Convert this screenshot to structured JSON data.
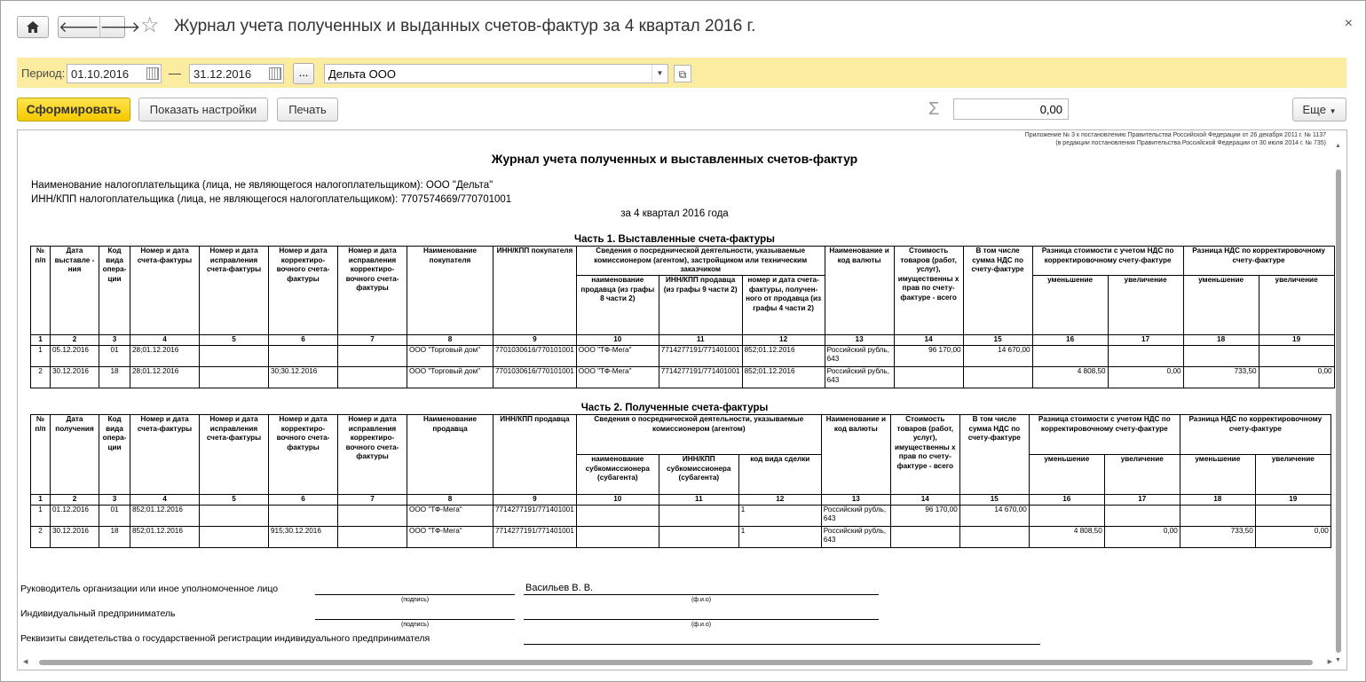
{
  "window": {
    "title": "Журнал учета полученных и выданных счетов-фактур за 4 квартал 2016 г.",
    "home_icon": "home-icon",
    "back_icon": "arrow-left-icon",
    "forward_icon": "arrow-right-icon",
    "favorite_icon": "star-icon",
    "close_label": "×"
  },
  "filter": {
    "period_label": "Период:",
    "date_from": "01.10.2016",
    "dash": "—",
    "date_to": "31.12.2016",
    "select_period_label": "...",
    "organization": "Дельта ООО"
  },
  "toolbar": {
    "generate_label": "Сформировать",
    "settings_label": "Показать настройки",
    "print_label": "Печать",
    "sum_value": "0,00",
    "more_label": "Еще"
  },
  "report": {
    "note_line1": "Приложение № 3 к постановлению Правительства Российской Федерации от 26 декабря 2011 г. № 1137",
    "note_line2": "(в редакции постановления Правительства Российской Федерации от 30 июля 2014 г. № 735)",
    "title": "Журнал учета полученных и выставленных счетов-фактур",
    "taxpayer_name": "Наименование налогоплательщика (лица, не являющегося налогоплательщиком): ООО \"Дельта\"",
    "taxpayer_inn": "ИНН/КПП налогоплательщика (лица, не являющегося налогоплательщиком): 7707574669/770701001",
    "period": "за 4 квартал 2016 года",
    "part1": {
      "title": "Часть 1. Выставленные счета-фактуры",
      "headers": {
        "h1": "№ п/п",
        "h2": "Дата выставле - ния",
        "h3": "Код вида опера- ции",
        "h4": "Номер и дата счета-фактуры",
        "h5": "Номер и дата исправления счета-фактуры",
        "h6": "Номер и дата корректиро- вочного счета-фактуры",
        "h7": "Номер и дата исправления корректиро- вочного счета- фактуры",
        "h8": "Наименование покупателя",
        "h9": "ИНН/КПП покупателя",
        "h10_12": "Сведения о посреднической деятельности, указываемые комиссионером (агентом), застройщиком или техническим заказчиком",
        "h10": "наименование продавца (из графы 8 части 2)",
        "h11": "ИНН/КПП продавца (из графы 9 части 2)",
        "h12": "номер и дата счета- фактуры, получен- ного от продавца (из графы 4 части 2)",
        "h13": "Наименование и код валюты",
        "h14": "Стоимость товаров (работ, услуг), имущественны х прав по счету- фактуре - всего",
        "h15": "В том числе сумма НДС по счету-фактуре",
        "h16_17": "Разница стоимости с учетом НДС по корректировочному счету-фактуре",
        "h16": "уменьшение",
        "h17": "увеличение",
        "h18_19": "Разница НДС по корректировочному счету-фактуре",
        "h18": "уменьшение",
        "h19": "увеличение"
      },
      "col_numbers": [
        "1",
        "2",
        "3",
        "4",
        "5",
        "6",
        "7",
        "8",
        "9",
        "10",
        "11",
        "12",
        "13",
        "14",
        "15",
        "16",
        "17",
        "18",
        "19"
      ],
      "rows": [
        [
          "1",
          "05.12.2016",
          "01",
          "28;01.12.2016",
          "",
          "",
          "",
          "ООО \"Торговый дом\"",
          "7701030616/770101001",
          "ООО \"ТФ-Мега\"",
          "7714277191/771401001",
          "852;01.12.2016",
          "Российский рубль, 643",
          "96 170,00",
          "14 670,00",
          "",
          "",
          "",
          ""
        ],
        [
          "2",
          "30.12.2016",
          "18",
          "28;01.12.2016",
          "",
          "30;30.12.2016",
          "",
          "ООО \"Торговый дом\"",
          "7701030616/770101001",
          "ООО \"ТФ-Мега\"",
          "7714277191/771401001",
          "852;01.12.2016",
          "Российский рубль, 643",
          "",
          "",
          "4 808,50",
          "0,00",
          "733,50",
          "0,00"
        ]
      ]
    },
    "part2": {
      "title": "Часть 2. Полученные счета-фактуры",
      "headers": {
        "h1": "№ п/п",
        "h2": "Дата получения",
        "h3": "Код вида опера- ции",
        "h4": "Номер и дата счета-фактуры",
        "h5": "Номер и дата исправления счета-фактуры",
        "h6": "Номер и дата корректиро- вочного счета-фактуры",
        "h7": "Номер и дата исправления корректиро- вочного счета- фактуры",
        "h8": "Наименование продавца",
        "h9": "ИНН/КПП продавца",
        "h10_12": "Сведения о посреднической деятельности, указываемые комиссионером (агентом)",
        "h10": "наименование субкомиссионера (субагента)",
        "h11": "ИНН/КПП субкомиссионера (субагента)",
        "h12": "код вида сделки",
        "h13": "Наименование и код валюты",
        "h14": "Стоимость товаров (работ, услуг), имущественны х прав по счету- фактуре - всего",
        "h15": "В том числе сумма НДС по счету-фактуре",
        "h16_17": "Разница стоимости с учетом НДС по корректировочному счету-фактуре",
        "h16": "уменьшение",
        "h17": "увеличение",
        "h18_19": "Разница НДС по корректировочному счету-фактуре",
        "h18": "уменьшение",
        "h19": "увеличение"
      },
      "col_numbers": [
        "1",
        "2",
        "3",
        "4",
        "5",
        "6",
        "7",
        "8",
        "9",
        "10",
        "11",
        "12",
        "13",
        "14",
        "15",
        "16",
        "17",
        "18",
        "19"
      ],
      "rows": [
        [
          "1",
          "01.12.2016",
          "01",
          "852;01.12.2016",
          "",
          "",
          "",
          "ООО \"ТФ-Мега\"",
          "7714277191/771401001",
          "",
          "",
          "1",
          "Российский рубль, 643",
          "96 170,00",
          "14 670,00",
          "",
          "",
          "",
          ""
        ],
        [
          "2",
          "30.12.2016",
          "18",
          "852;01.12.2016",
          "",
          "915;30.12.2016",
          "",
          "ООО \"ТФ-Мега\"",
          "7714277191/771401001",
          "",
          "",
          "1",
          "Российский рубль, 643",
          "",
          "",
          "4 808,50",
          "0,00",
          "733,50",
          "0,00"
        ]
      ]
    },
    "signatures": {
      "head_label": "Руководитель организации или иное уполномоченное лицо",
      "head_name": "Васильев В. В.",
      "signature_caption": "(подпись)",
      "fio_caption": "(ф.и.о)",
      "ie_label": "Индивидуальный предприниматель",
      "cert_label": "Реквизиты свидетельства о государственной регистрации индивидуального предпринимателя"
    }
  }
}
